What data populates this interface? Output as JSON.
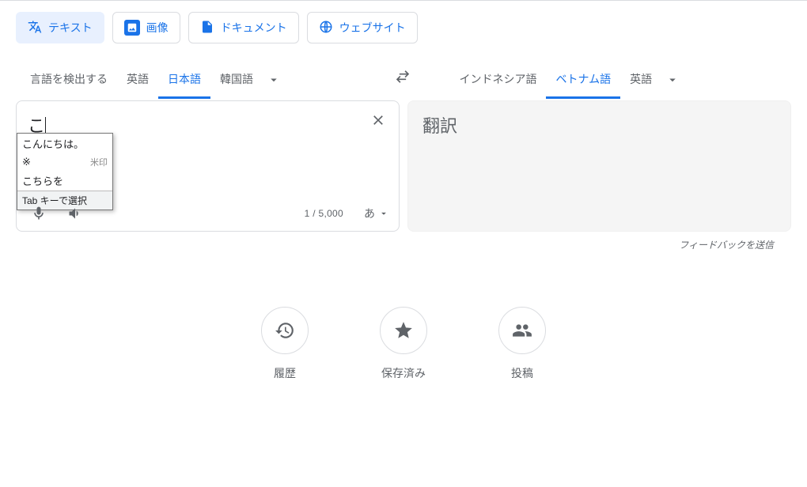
{
  "mode_tabs": {
    "text": "テキスト",
    "image": "画像",
    "document": "ドキュメント",
    "website": "ウェブサイト"
  },
  "source_langs": {
    "detect": "言語を検出する",
    "en": "英語",
    "ja": "日本語",
    "ko": "韓国語",
    "active": "ja"
  },
  "target_langs": {
    "id": "インドネシア語",
    "vi": "ベトナム語",
    "en": "英語",
    "active": "vi"
  },
  "input": {
    "text": "こ",
    "char_count": "1 / 5,000",
    "ime_glyph": "あ"
  },
  "suggestions": {
    "row1_left": "こんにちは。",
    "row1_right": "",
    "row2_left": "※",
    "row2_right": "米印",
    "row3_left": "こちらを",
    "hint": "Tab キーで選択"
  },
  "output": {
    "placeholder": "翻訳"
  },
  "feedback_link": "フィードバックを送信",
  "bottom": {
    "history": "履歴",
    "saved": "保存済み",
    "contribute": "投稿"
  }
}
